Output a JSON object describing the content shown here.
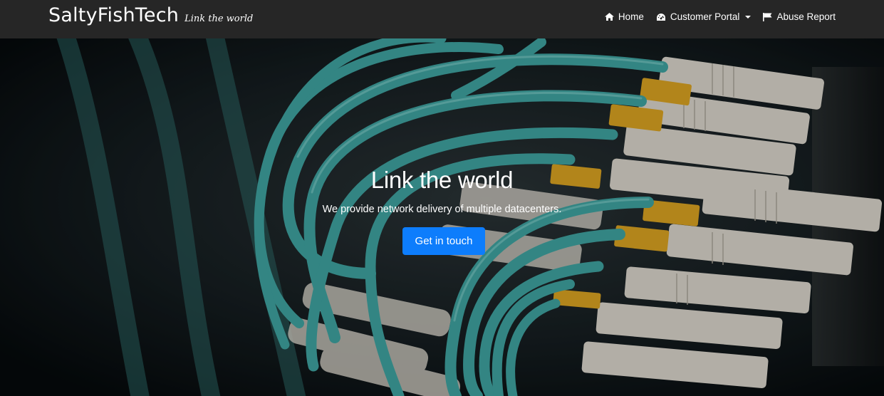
{
  "brand": {
    "name": "SaltyFishTech",
    "tagline": "Link the world"
  },
  "nav": {
    "home": {
      "label": "Home",
      "icon": "home-icon"
    },
    "portal": {
      "label": "Customer Portal",
      "icon": "dashboard-icon"
    },
    "abuse": {
      "label": "Abuse Report",
      "icon": "flag-icon"
    }
  },
  "hero": {
    "title": "Link the world",
    "subtitle": "We provide network delivery of multiple datacenters.",
    "cta_label": "Get in touch"
  },
  "colors": {
    "navbar": "#262626",
    "cta": "#0d7dfc",
    "cable": "#3fa3a0",
    "connector": "#d9a321"
  }
}
